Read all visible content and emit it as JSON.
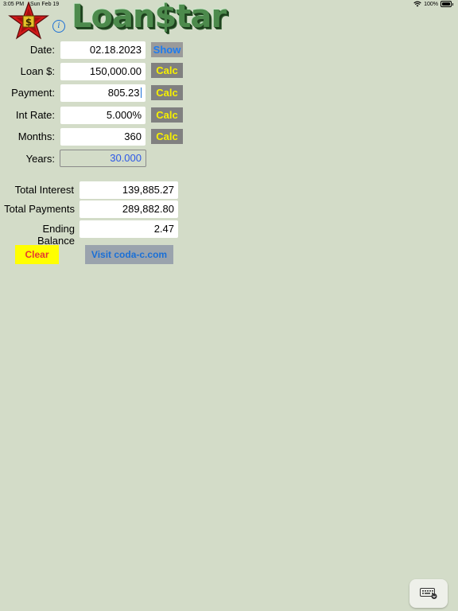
{
  "status": {
    "time": "3:05 PM",
    "date": "Sun Feb 19",
    "battery": "100%"
  },
  "app": {
    "logo_text": "Loan$tar",
    "info_icon": "i"
  },
  "form": {
    "date_label": "Date:",
    "date_value": "02.18.2023",
    "show_label": "Show",
    "loan_label": "Loan $:",
    "loan_value": "150,000.00",
    "payment_label": "Payment:",
    "payment_value": "805.23",
    "rate_label": "Int Rate:",
    "rate_value": "5.000%",
    "months_label": "Months:",
    "months_value": "360",
    "years_label": "Years:",
    "years_value": "30.000",
    "calc_label": "Calc"
  },
  "results": {
    "total_interest_label": "Total Interest",
    "total_interest_value": "139,885.27",
    "total_payments_label": "Total Payments",
    "total_payments_value": "289,882.80",
    "ending_balance_label": "Ending Balance",
    "ending_balance_value": "2.47"
  },
  "actions": {
    "clear_label": "Clear",
    "visit_label": "Visit coda-c.com"
  },
  "icons": {
    "wifi": "wifi-icon",
    "battery": "battery-icon",
    "keyboard": "keyboard-icon",
    "star": "star-logo-icon"
  },
  "colors": {
    "background": "#d3dcc8",
    "calc_text": "#f6f000",
    "show_text": "#1d7cf0",
    "clear_bg": "#ffff00",
    "clear_text": "#e5392f",
    "readonly_text": "#2c58e8"
  }
}
